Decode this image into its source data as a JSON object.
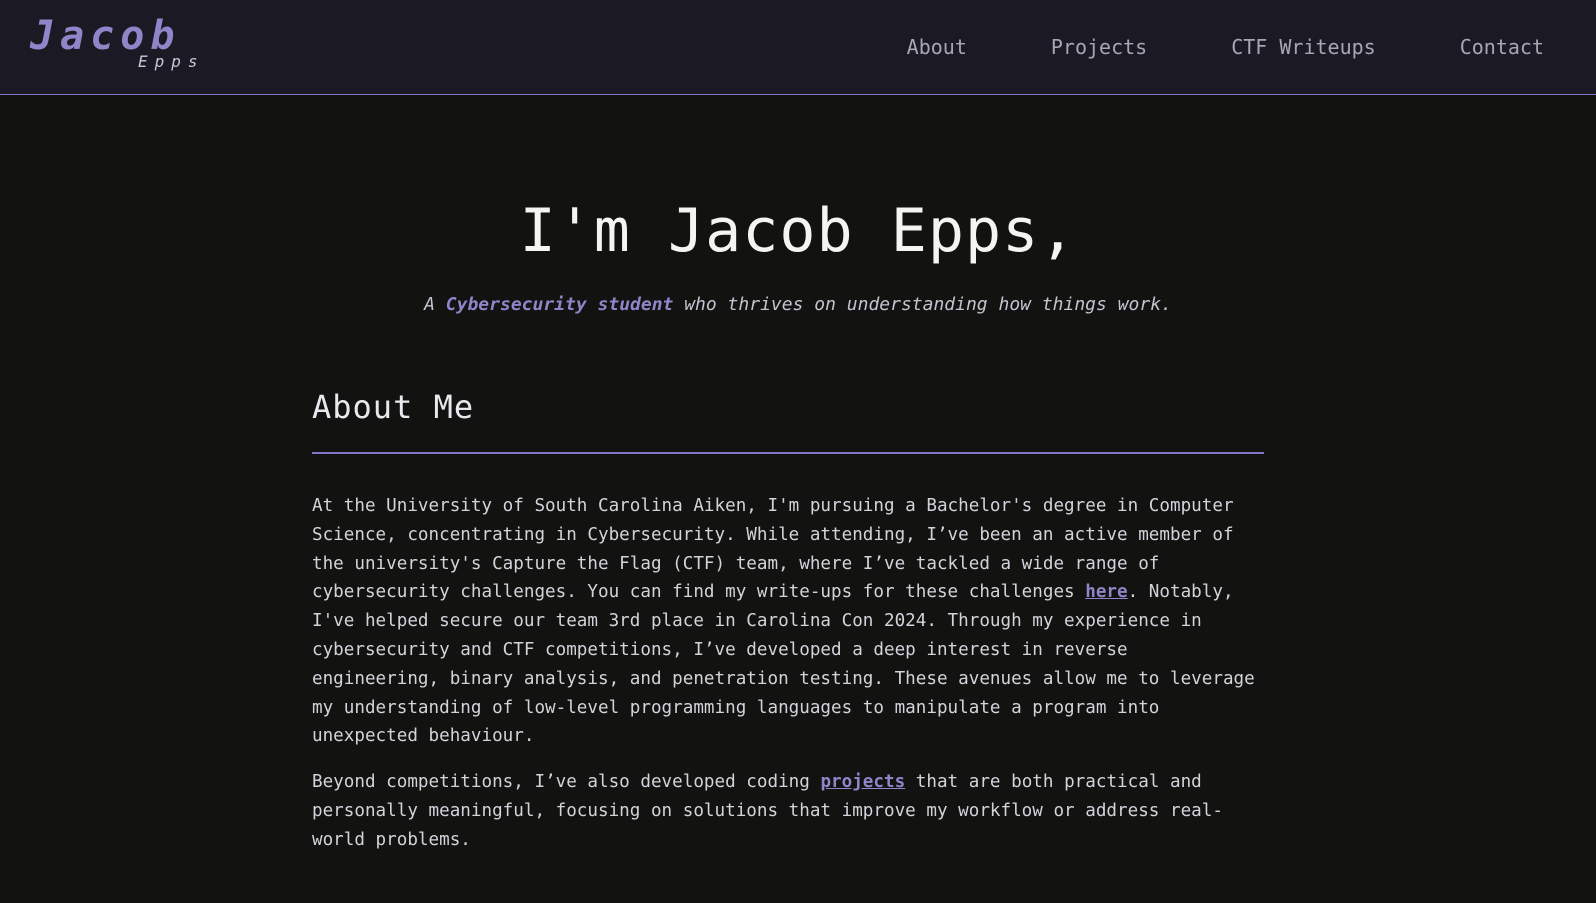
{
  "header": {
    "logo_first": "Jacob",
    "logo_last": "Epps",
    "nav": [
      {
        "label": "About"
      },
      {
        "label": "Projects"
      },
      {
        "label": "CTF Writeups"
      },
      {
        "label": "Contact"
      }
    ]
  },
  "hero": {
    "title": "I'm Jacob Epps,",
    "subtitle_prefix": "A ",
    "subtitle_accent": "Cybersecurity student",
    "subtitle_suffix": " who thrives on understanding how things work."
  },
  "about": {
    "heading": "About Me",
    "p1_before_link": "At the University of South Carolina Aiken, I'm pursuing a Bachelor's degree in Computer Science, concentrating in Cybersecurity. While attending, I’ve been an active member of the university's Capture the Flag (CTF) team, where I’ve tackled a wide range of cybersecurity challenges. You can find my write-ups for these challenges ",
    "p1_link": "here",
    "p1_after_link": ". Notably, I've helped secure our team 3rd place in Carolina Con 2024. Through my experience in cybersecurity and CTF competitions, I’ve developed a deep interest in reverse engineering, binary analysis, and penetration testing. These avenues allow me to leverage my understanding of low-level programming languages to manipulate a program into unexpected behaviour.",
    "p2_before_link": "Beyond competitions, I’ve also developed coding ",
    "p2_link": "projects",
    "p2_after_link": " that are both practical and personally meaningful, focusing on solutions that improve my workflow or address real-world problems."
  },
  "colors": {
    "accent": "#8f86c9",
    "header_bg": "#1b1a24",
    "page_bg": "#121210"
  }
}
